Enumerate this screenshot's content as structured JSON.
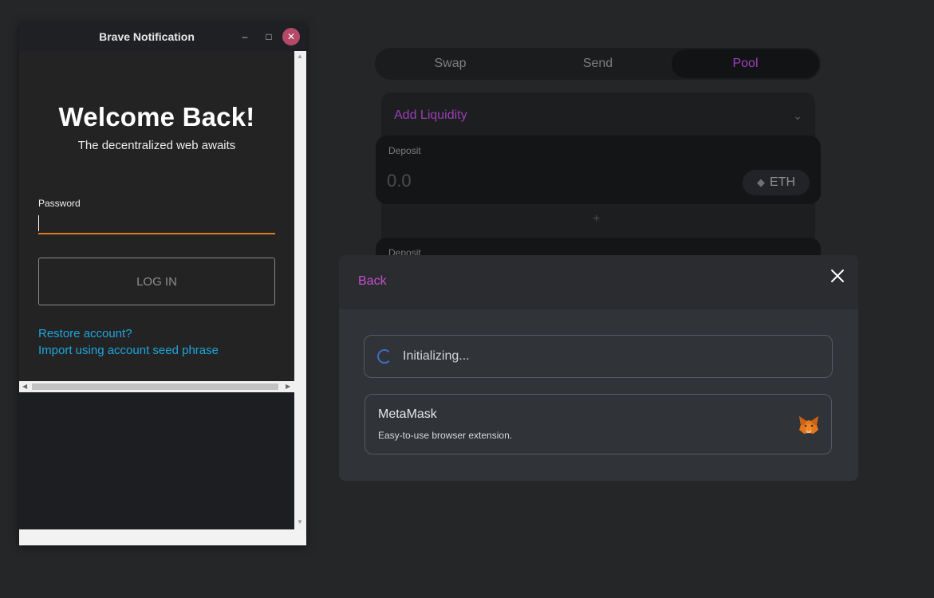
{
  "dapp": {
    "tabs": [
      {
        "label": "Swap",
        "active": false
      },
      {
        "label": "Send",
        "active": false
      },
      {
        "label": "Pool",
        "active": true
      }
    ],
    "add_liquidity": "Add Liquidity",
    "deposit_label": "Deposit",
    "deposit_amount": "0.0",
    "token": "ETH",
    "plus": "+",
    "deposit2_label": "Deposit"
  },
  "modal": {
    "back": "Back",
    "initializing": "Initializing...",
    "wallet_name": "MetaMask",
    "wallet_desc": "Easy-to-use browser extension."
  },
  "notification": {
    "window_title": "Brave Notification",
    "welcome": "Welcome Back!",
    "subtitle": "The decentralized web awaits",
    "password_label": "Password",
    "login": "LOG IN",
    "restore": "Restore account?",
    "import": "Import using account seed phrase"
  },
  "colors": {
    "accent_purple": "#a03fbf",
    "link_blue": "#1ea6df",
    "input_focus_orange": "#e07a1f",
    "close_button": "#b6496a"
  }
}
